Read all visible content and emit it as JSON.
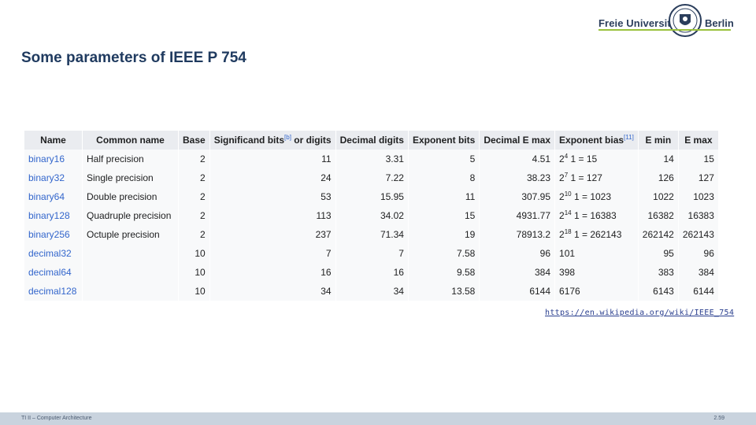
{
  "logo": {
    "left": "Freie Universität",
    "right": "Berlin"
  },
  "title": "Some parameters of IEEE P 754",
  "table": {
    "headers": [
      {
        "text": "Name"
      },
      {
        "text": "Common name"
      },
      {
        "text": "Base"
      },
      {
        "text": "Significand bits",
        "sup": "[b]",
        "after": " or digits"
      },
      {
        "text": "Decimal digits"
      },
      {
        "text": "Exponent bits"
      },
      {
        "text": "Decimal E max"
      },
      {
        "text": "Exponent bias",
        "sup": "[11]"
      },
      {
        "text": "E min"
      },
      {
        "text": "E max"
      }
    ],
    "rows": [
      {
        "name": "binary16",
        "common": "Half precision",
        "base": "2",
        "sig": "11",
        "dec": "3.31",
        "exp": "5",
        "demax": "4.51",
        "bias_base": "2",
        "bias_exp": "4",
        "bias_val": "1 = 15",
        "emin": "14",
        "emax": "15"
      },
      {
        "name": "binary32",
        "common": "Single precision",
        "base": "2",
        "sig": "24",
        "dec": "7.22",
        "exp": "8",
        "demax": "38.23",
        "bias_base": "2",
        "bias_exp": "7",
        "bias_val": "1 = 127",
        "emin": "126",
        "emax": "127"
      },
      {
        "name": "binary64",
        "common": "Double precision",
        "base": "2",
        "sig": "53",
        "dec": "15.95",
        "exp": "11",
        "demax": "307.95",
        "bias_base": "2",
        "bias_exp": "10",
        "bias_val": "1 = 1023",
        "emin": "1022",
        "emax": "1023"
      },
      {
        "name": "binary128",
        "common": "Quadruple precision",
        "base": "2",
        "sig": "113",
        "dec": "34.02",
        "exp": "15",
        "demax": "4931.77",
        "bias_base": "2",
        "bias_exp": "14",
        "bias_val": "1 = 16383",
        "emin": "16382",
        "emax": "16383"
      },
      {
        "name": "binary256",
        "common": "Octuple precision",
        "base": "2",
        "sig": "237",
        "dec": "71.34",
        "exp": "19",
        "demax": "78913.2",
        "bias_base": "2",
        "bias_exp": "18",
        "bias_val": "1 = 262143",
        "emin": "262142",
        "emax": "262143"
      },
      {
        "name": "decimal32",
        "common": "",
        "base": "10",
        "sig": "7",
        "dec": "7",
        "exp": "7.58",
        "demax": "96",
        "bias_base": "101",
        "bias_exp": "",
        "bias_val": "",
        "emin": "95",
        "emax": "96"
      },
      {
        "name": "decimal64",
        "common": "",
        "base": "10",
        "sig": "16",
        "dec": "16",
        "exp": "9.58",
        "demax": "384",
        "bias_base": "398",
        "bias_exp": "",
        "bias_val": "",
        "emin": "383",
        "emax": "384"
      },
      {
        "name": "decimal128",
        "common": "",
        "base": "10",
        "sig": "34",
        "dec": "34",
        "exp": "13.58",
        "demax": "6144",
        "bias_base": "6176",
        "bias_exp": "",
        "bias_val": "",
        "emin": "6143",
        "emax": "6144"
      }
    ]
  },
  "source_link": "https://en.wikipedia.org/wiki/IEEE_754",
  "footer": {
    "text": "TI II – Computer Architecture",
    "page": "2.59"
  }
}
